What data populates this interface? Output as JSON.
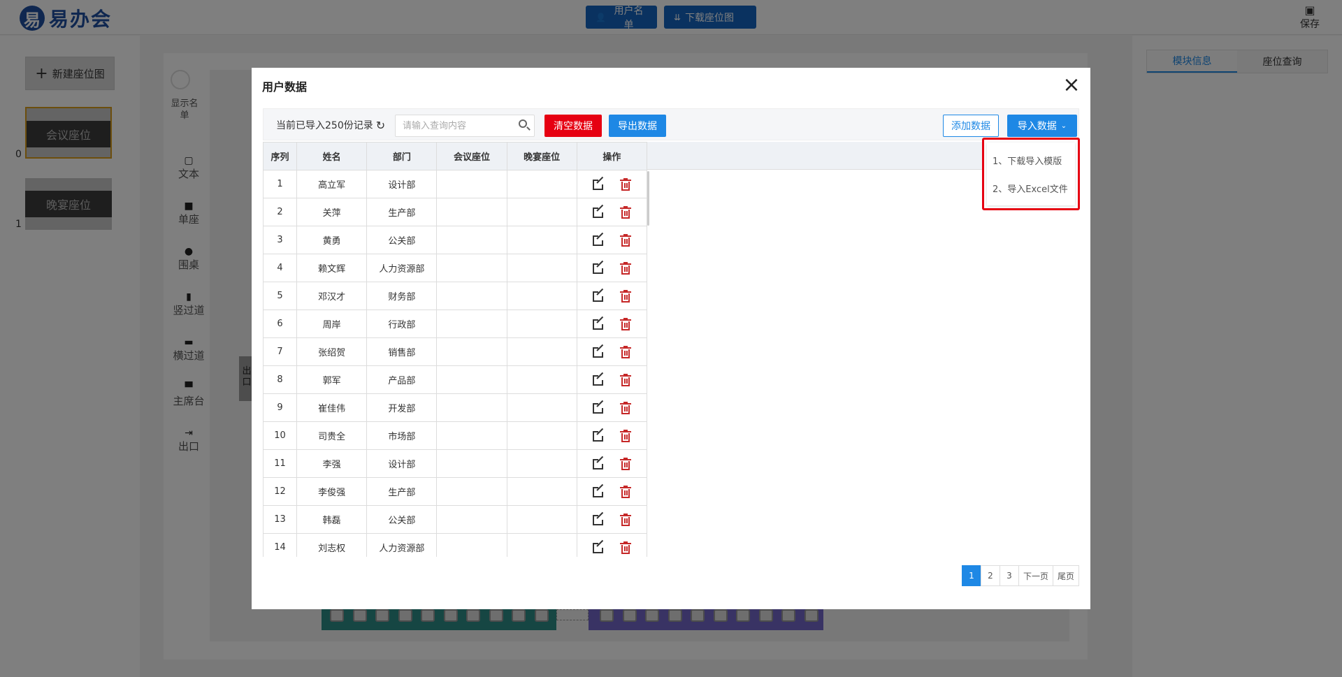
{
  "app": {
    "logo_mark": "易",
    "logo_text": "易办会",
    "top_buttons": {
      "user_list": "用户名单",
      "download_seatmap": "下载座位图"
    },
    "save_label": "保存"
  },
  "left_panel": {
    "new_seatmap": "新建座位图",
    "seat_items": [
      {
        "label": "会议座位",
        "index": "0"
      },
      {
        "label": "晚宴座位",
        "index": "1"
      }
    ]
  },
  "tools": {
    "show_list": "显示名单",
    "items": [
      "文本",
      "单座",
      "围桌",
      "竖过道",
      "横过道",
      "主席台",
      "出口"
    ]
  },
  "canvas": {
    "exit_label": "出口"
  },
  "right_panel": {
    "tabs": [
      "模块信息",
      "座位查询"
    ]
  },
  "modal": {
    "title": "用户数据",
    "count_text": "当前已导入250份记录",
    "search_placeholder": "请输入查询内容",
    "buttons": {
      "clear": "清空数据",
      "export": "导出数据",
      "add": "添加数据",
      "import": "导入数据"
    },
    "dropdown": [
      "1、下载导入模版",
      "2、导入Excel文件"
    ],
    "columns": [
      "序列",
      "姓名",
      "部门",
      "会议座位",
      "晚宴座位",
      "操作"
    ],
    "rows": [
      {
        "idx": "1",
        "name": "高立军",
        "dept": "设计部"
      },
      {
        "idx": "2",
        "name": "关萍",
        "dept": "生产部"
      },
      {
        "idx": "3",
        "name": "黄勇",
        "dept": "公关部"
      },
      {
        "idx": "4",
        "name": "赖文辉",
        "dept": "人力资源部"
      },
      {
        "idx": "5",
        "name": "邓汉才",
        "dept": "财务部"
      },
      {
        "idx": "6",
        "name": "周岸",
        "dept": "行政部"
      },
      {
        "idx": "7",
        "name": "张绍贺",
        "dept": "销售部"
      },
      {
        "idx": "8",
        "name": "郭军",
        "dept": "产品部"
      },
      {
        "idx": "9",
        "name": "崔佳伟",
        "dept": "开发部"
      },
      {
        "idx": "10",
        "name": "司贵全",
        "dept": "市场部"
      },
      {
        "idx": "11",
        "name": "李强",
        "dept": "设计部"
      },
      {
        "idx": "12",
        "name": "李俊强",
        "dept": "生产部"
      },
      {
        "idx": "13",
        "name": "韩磊",
        "dept": "公关部"
      },
      {
        "idx": "14",
        "name": "刘志权",
        "dept": "人力资源部"
      }
    ],
    "pagination": [
      "1",
      "2",
      "3",
      "下一页",
      "尾页"
    ]
  },
  "colors": {
    "primary": "#1e88e5",
    "danger": "#e60012",
    "teal": "#2c8c86",
    "purple": "#7266c9"
  }
}
